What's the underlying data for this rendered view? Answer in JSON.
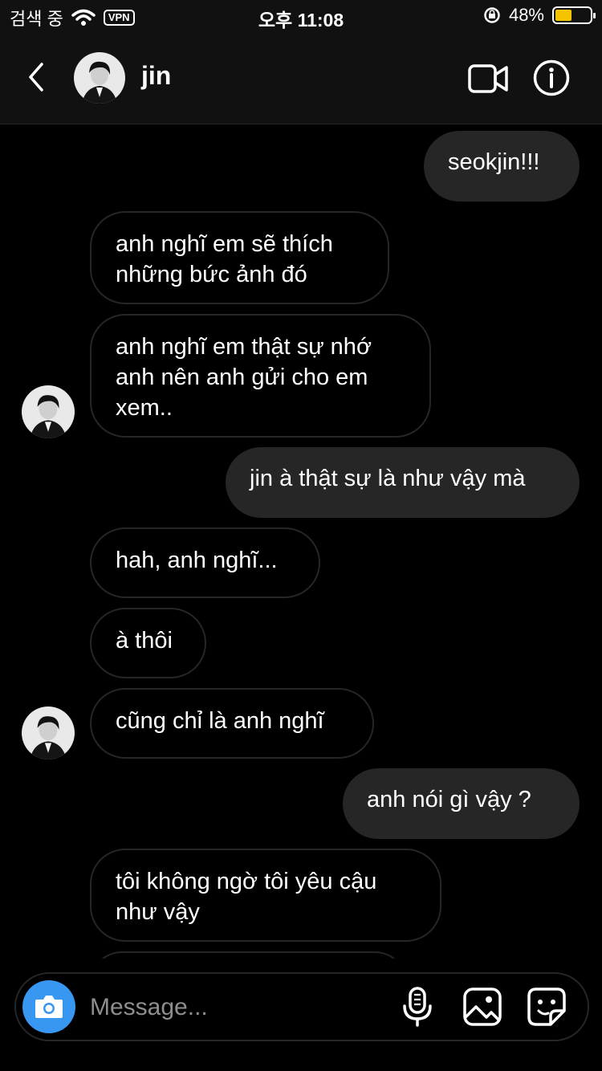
{
  "status_bar": {
    "carrier": "검색 중",
    "vpn": "VPN",
    "time": "오후 11:08",
    "battery": "48%",
    "battery_level": 0.48,
    "battery_color": "#f5c400"
  },
  "header": {
    "name": "jin",
    "icons": [
      "back-icon",
      "avatar",
      "video-call-icon",
      "info-icon"
    ]
  },
  "messages": [
    {
      "dir": "out",
      "text": "seokjin!!!"
    },
    {
      "dir": "in",
      "text": "anh nghĩ em sẽ thích\nnhững bức ảnh đó"
    },
    {
      "dir": "in",
      "text": "anh nghĩ em thật sự nhớ\nanh nên anh gửi cho em\nxem.."
    },
    {
      "dir": "out",
      "text": "jin à thật sự là như vậy mà"
    },
    {
      "dir": "in",
      "text": "hah, anh nghĩ..."
    },
    {
      "dir": "in",
      "text": "à thôi"
    },
    {
      "dir": "in",
      "text": "cũng chỉ là anh nghĩ"
    },
    {
      "dir": "out",
      "text": "anh nói gì vậy ?"
    },
    {
      "dir": "in",
      "text": "tôi không ngờ tôi yêu cậu\nnhư vậy"
    }
  ],
  "composer": {
    "placeholder": "Message...",
    "icons": [
      "camera-icon",
      "microphone-icon",
      "gallery-icon",
      "sticker-icon"
    ],
    "accent": "#3897f0"
  },
  "colors": {
    "background": "#000000",
    "outgoing_bubble": "#262626",
    "incoming_border": "#262626"
  }
}
